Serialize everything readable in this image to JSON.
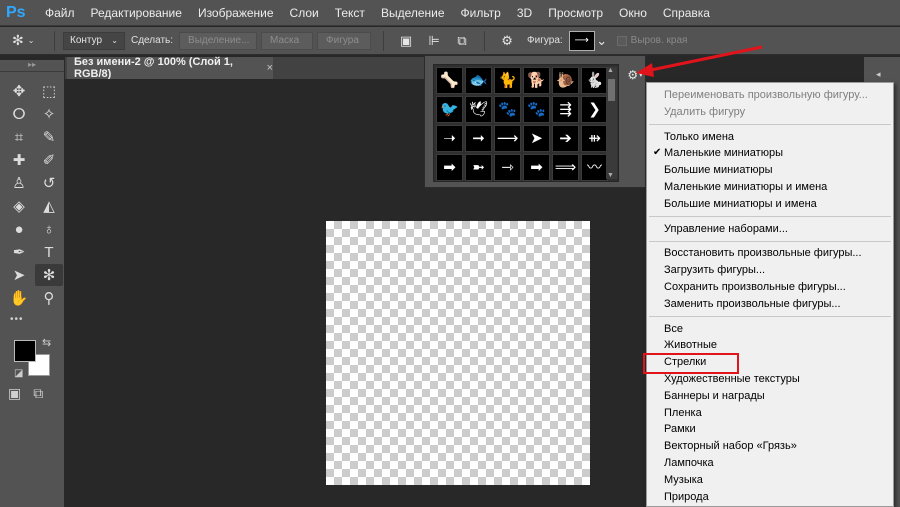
{
  "menubar": {
    "logo": "Ps",
    "items": [
      "Файл",
      "Редактирование",
      "Изображение",
      "Слои",
      "Текст",
      "Выделение",
      "Фильтр",
      "3D",
      "Просмотр",
      "Окно",
      "Справка"
    ]
  },
  "options": {
    "mode_value": "Контур",
    "make_label": "Сделать:",
    "make_buttons": [
      "Выделение...",
      "Маска",
      "Фигура"
    ],
    "shape_label": "Фигура:",
    "align_edges_label": "Выров. края"
  },
  "document": {
    "tab_title": "Без имени-2 @ 100% (Слой 1, RGB/8)",
    "close_glyph": "×"
  },
  "tools": [
    {
      "name": "move-tool-icon",
      "glyph": "✥"
    },
    {
      "name": "marquee-tool-icon",
      "glyph": "⬚"
    },
    {
      "name": "lasso-tool-icon",
      "glyph": "ⵔ"
    },
    {
      "name": "magic-wand-tool-icon",
      "glyph": "✧"
    },
    {
      "name": "crop-tool-icon",
      "glyph": "⌗"
    },
    {
      "name": "eyedropper-tool-icon",
      "glyph": "✎"
    },
    {
      "name": "healing-brush-tool-icon",
      "glyph": "✚"
    },
    {
      "name": "brush-tool-icon",
      "glyph": "✐"
    },
    {
      "name": "clone-stamp-tool-icon",
      "glyph": "♙"
    },
    {
      "name": "history-brush-tool-icon",
      "glyph": "↺"
    },
    {
      "name": "eraser-tool-icon",
      "glyph": "◈"
    },
    {
      "name": "paint-bucket-tool-icon",
      "glyph": "◭"
    },
    {
      "name": "blur-tool-icon",
      "glyph": "●"
    },
    {
      "name": "dodge-tool-icon",
      "glyph": "♁"
    },
    {
      "name": "pen-tool-icon",
      "glyph": "✒"
    },
    {
      "name": "type-tool-icon",
      "glyph": "T"
    },
    {
      "name": "path-selection-tool-icon",
      "glyph": "➤"
    },
    {
      "name": "custom-shape-tool-icon",
      "glyph": "✻"
    },
    {
      "name": "hand-tool-icon",
      "glyph": "✋"
    },
    {
      "name": "zoom-tool-icon",
      "glyph": "⚲"
    }
  ],
  "more_tools_glyph": "•••",
  "shapes": [
    "🦴",
    "🐟",
    "🐈",
    "🐕",
    "🐌",
    "🐇",
    "🐦",
    "🕊",
    "🐾",
    "🐾",
    "⇶",
    "❯",
    "➝",
    "➞",
    "⟶",
    "➤",
    "➔",
    "⇻",
    "➡",
    "➼",
    "⇾",
    "➡",
    "⟹",
    "〰"
  ],
  "menu": {
    "items": [
      {
        "label": "Переименовать произвольную фигуру...",
        "disabled": true
      },
      {
        "label": "Удалить фигуру",
        "disabled": true
      },
      {
        "sep": true
      },
      {
        "label": "Только имена"
      },
      {
        "label": "Маленькие миниатюры",
        "checked": true
      },
      {
        "label": "Большие миниатюры"
      },
      {
        "label": "Маленькие миниатюры и имена"
      },
      {
        "label": "Большие миниатюры и имена"
      },
      {
        "sep": true
      },
      {
        "label": "Управление наборами..."
      },
      {
        "sep": true
      },
      {
        "label": "Восстановить произвольные фигуры..."
      },
      {
        "label": "Загрузить фигуры..."
      },
      {
        "label": "Сохранить произвольные фигуры..."
      },
      {
        "label": "Заменить произвольные фигуры..."
      },
      {
        "sep": true
      },
      {
        "label": "Все"
      },
      {
        "label": "Животные"
      },
      {
        "label": "Стрелки",
        "highlighted": true
      },
      {
        "label": "Художественные текстуры"
      },
      {
        "label": "Баннеры и награды"
      },
      {
        "label": "Пленка"
      },
      {
        "label": "Рамки"
      },
      {
        "label": "Векторный набор «Грязь»"
      },
      {
        "label": "Лампочка"
      },
      {
        "label": "Музыка"
      },
      {
        "label": "Природа"
      }
    ]
  },
  "colors": {
    "ui_dark": "#535353",
    "workspace": "#282828",
    "annotation_red": "#e0141a"
  }
}
